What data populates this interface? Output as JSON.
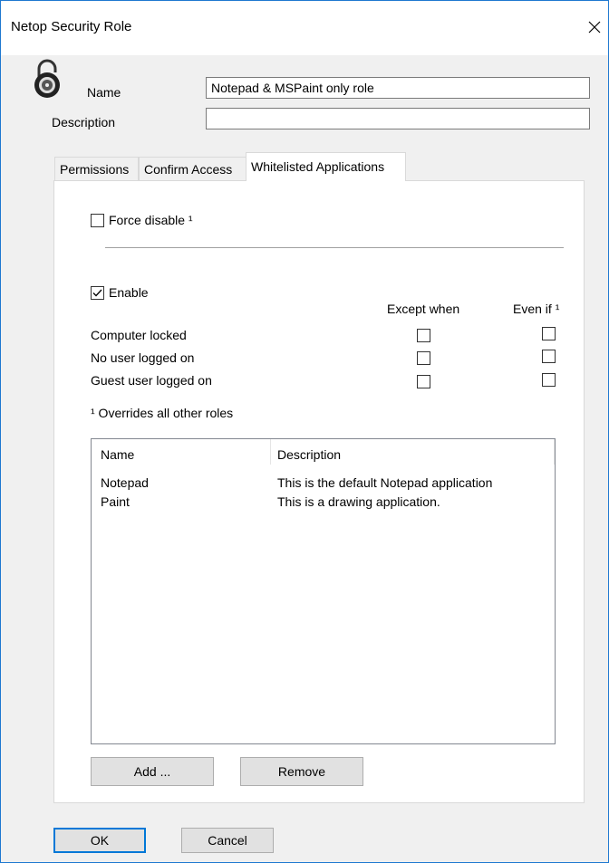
{
  "window": {
    "title": "Netop Security Role"
  },
  "form": {
    "name_label": "Name",
    "name_value": "Notepad & MSPaint only role",
    "description_label": "Description",
    "description_value": ""
  },
  "tabs": [
    {
      "label": "Permissions",
      "active": false
    },
    {
      "label": "Confirm Access",
      "active": false
    },
    {
      "label": "Whitelisted Applications",
      "active": true
    }
  ],
  "whitelist": {
    "force_disable_label": "Force disable ¹",
    "force_disable_checked": false,
    "enable_label": "Enable",
    "enable_checked": true,
    "except_when_header": "Except when",
    "even_if_header": "Even if ¹",
    "conditions": [
      {
        "label": "Computer locked",
        "except_when": false,
        "even_if": false
      },
      {
        "label": "No user logged on",
        "except_when": false,
        "even_if": false
      },
      {
        "label": "Guest user logged on",
        "except_when": false,
        "even_if": false
      }
    ],
    "footnote": "¹ Overrides all other roles",
    "list": {
      "columns": [
        "Name",
        "Description"
      ],
      "rows": [
        {
          "name": "Notepad",
          "description": "This is the default Notepad application"
        },
        {
          "name": "Paint",
          "description": "This is a drawing application."
        }
      ]
    },
    "add_button": "Add ...",
    "remove_button": "Remove"
  },
  "footer": {
    "ok_button": "OK",
    "cancel_button": "Cancel"
  },
  "colors": {
    "accent": "#0078d7",
    "border": "#1e78d0"
  }
}
